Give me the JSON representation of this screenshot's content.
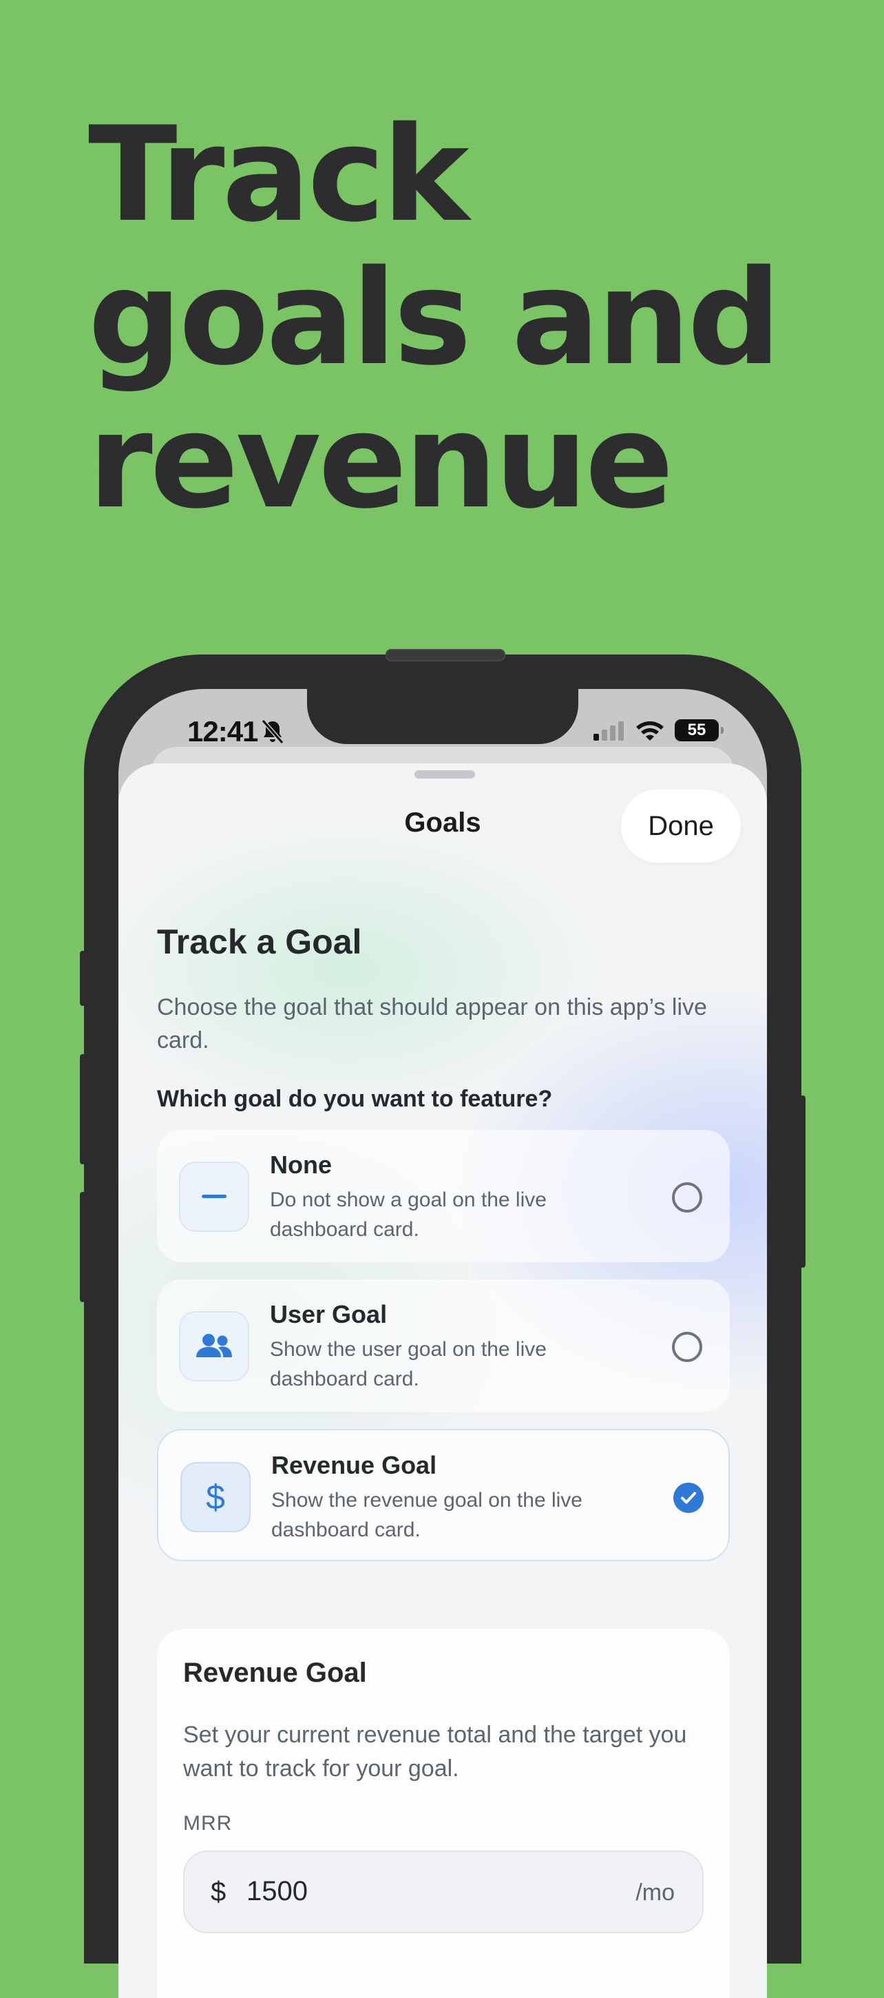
{
  "headline": [
    "Track",
    "goals and",
    "revenue"
  ],
  "status_bar": {
    "time": "12:41",
    "battery": "55"
  },
  "nav": {
    "title": "Goals",
    "done_label": "Done"
  },
  "section": {
    "title": "Track a Goal",
    "description": "Choose the goal that should appear on this app’s live card.",
    "question": "Which goal do you want to feature?"
  },
  "options": [
    {
      "title": "None",
      "description": "Do not show a goal on the live dashboard card.",
      "icon": "minus-icon",
      "selected": false
    },
    {
      "title": "User Goal",
      "description": "Show the user goal on the live dashboard card.",
      "icon": "users-icon",
      "selected": false
    },
    {
      "title": "Revenue Goal",
      "description": "Show the revenue goal on the live dashboard card.",
      "icon": "dollar-icon",
      "selected": true
    }
  ],
  "revenue_card": {
    "title": "Revenue Goal",
    "description": "Set your current revenue total and the target you want to track for your goal.",
    "mrr_label": "MRR",
    "currency": "$",
    "mrr_value": "1500",
    "suffix": "/mo"
  },
  "colors": {
    "background": "#7ac465",
    "accent": "#2f7ad6",
    "text_dark": "#2d2d2f"
  }
}
